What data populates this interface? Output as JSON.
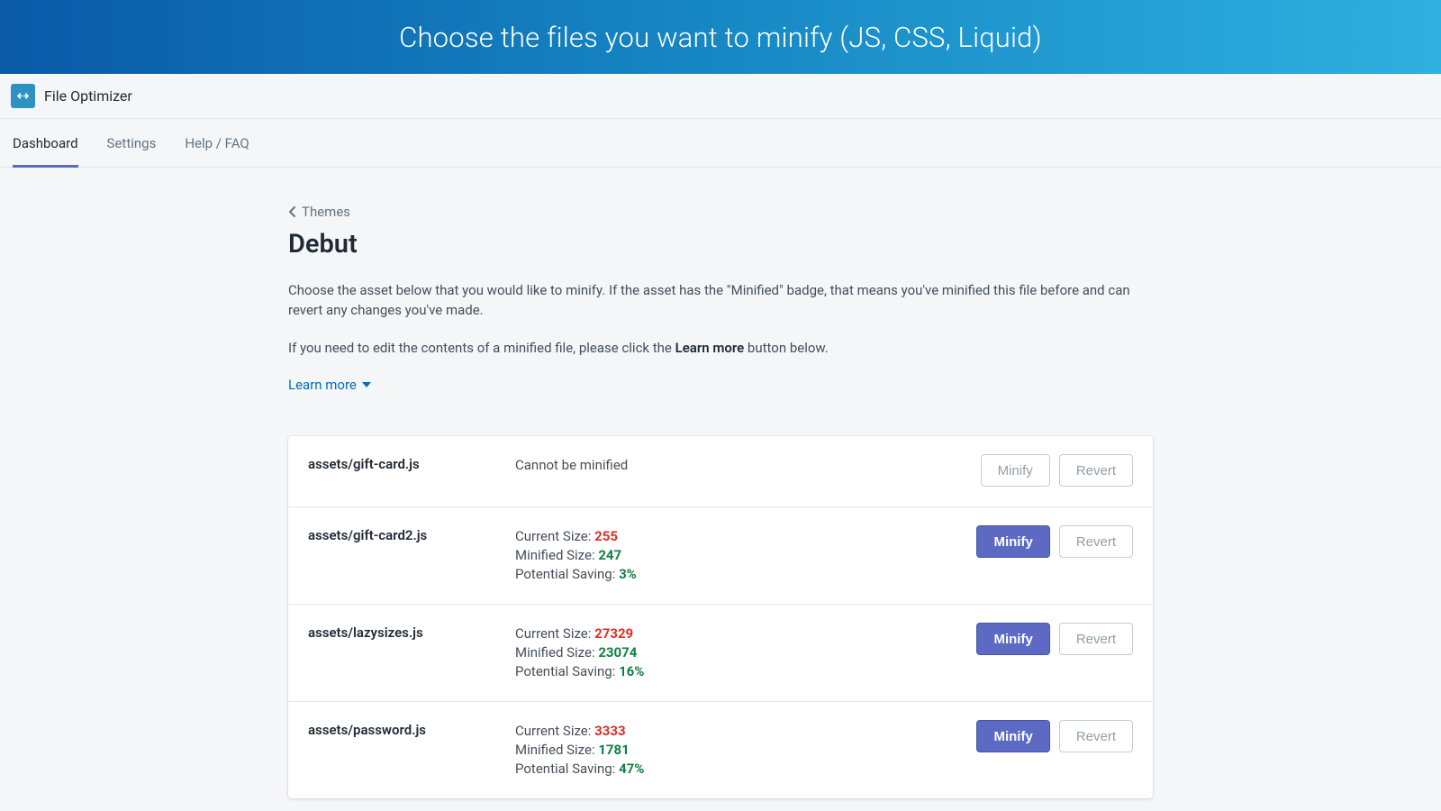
{
  "banner": {
    "text": "Choose the files you want to minify (JS, CSS, Liquid)"
  },
  "app": {
    "title": "File Optimizer"
  },
  "tabs": [
    {
      "label": "Dashboard",
      "active": true
    },
    {
      "label": "Settings",
      "active": false
    },
    {
      "label": "Help / FAQ",
      "active": false
    }
  ],
  "breadcrumb": {
    "label": "Themes"
  },
  "page": {
    "title": "Debut",
    "desc1": "Choose the asset below that you would like to minify. If the asset has the \"Minified\" badge, that means you've minified this file before and can revert any changes you've made.",
    "desc2_pre": "If you need to edit the contents of a minified file, please click the ",
    "desc2_bold": "Learn more",
    "desc2_post": " button below.",
    "learn_more_label": "Learn more"
  },
  "labels": {
    "current_size": "Current Size: ",
    "minified_size": "Minified Size: ",
    "potential_saving": "Potential Saving: ",
    "minify": "Minify",
    "revert": "Revert"
  },
  "rows": [
    {
      "name": "assets/gift-card.js",
      "status_text": "Cannot be minified",
      "minify_enabled": false,
      "revert_enabled": false,
      "has_sizes": false
    },
    {
      "name": "assets/gift-card2.js",
      "current": "255",
      "minified": "247",
      "saving": "3%",
      "minify_enabled": true,
      "revert_enabled": false,
      "has_sizes": true
    },
    {
      "name": "assets/lazysizes.js",
      "current": "27329",
      "minified": "23074",
      "saving": "16%",
      "minify_enabled": true,
      "revert_enabled": false,
      "has_sizes": true
    },
    {
      "name": "assets/password.js",
      "current": "3333",
      "minified": "1781",
      "saving": "47%",
      "minify_enabled": true,
      "revert_enabled": false,
      "has_sizes": true
    }
  ]
}
